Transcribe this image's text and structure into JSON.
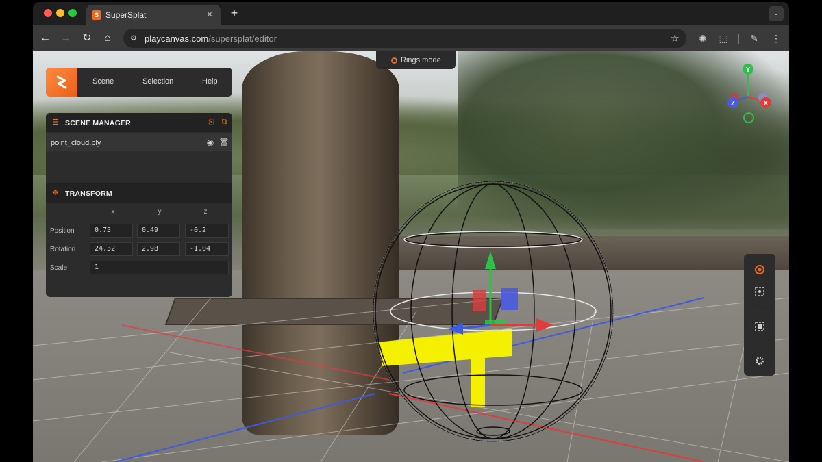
{
  "browser": {
    "tab_title": "SuperSplat",
    "tab_favicon_letter": "S",
    "tab_close": "×",
    "new_tab": "+",
    "tab_menu": "⌄",
    "url_domain": "playcanvas.com",
    "url_path": "/supersplat/editor",
    "icons": {
      "back": "←",
      "forward": "→",
      "reload": "↻",
      "home": "⌂",
      "site_info": "⚙",
      "bookmark": "☆",
      "extension1": "✺",
      "extensions": "⬚",
      "profile": "✎",
      "menu": "⋮"
    }
  },
  "viewport": {
    "mode_label": "Rings mode"
  },
  "menubar": {
    "items": [
      "Scene",
      "Selection",
      "Help"
    ]
  },
  "scene_manager": {
    "title": "SCENE MANAGER",
    "file": "point_cloud.ply"
  },
  "transform": {
    "title": "TRANSFORM",
    "axes": [
      "x",
      "y",
      "z"
    ],
    "position": {
      "label": "Position",
      "x": "0.73",
      "y": "0.49",
      "z": "-0.2"
    },
    "rotation": {
      "label": "Rotation",
      "x": "24.32",
      "y": "2.98",
      "z": "-1.04"
    },
    "scale": {
      "label": "Scale",
      "value": "1"
    }
  },
  "gizmo": {
    "y": "Y",
    "z": "Z",
    "x": "X"
  },
  "colors": {
    "accent": "#f26a21",
    "panel": "#2c2c2c",
    "axis_x": "#e23b3b",
    "axis_y": "#2fbf4a",
    "axis_z": "#3b5be2",
    "selection": "#f5f000"
  }
}
